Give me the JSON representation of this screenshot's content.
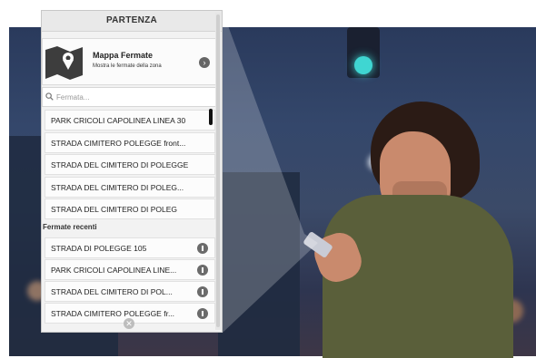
{
  "header": {
    "title": "PARTENZA"
  },
  "map_card": {
    "title": "Mappa Fermate",
    "subtitle": "Mostra le fermate della zona",
    "icon": "map-marker-icon"
  },
  "search": {
    "placeholder": "Fermata..."
  },
  "stops": [
    {
      "label": "PARK CRICOLI CAPOLINEA LINEA 30"
    },
    {
      "label": "STRADA CIMITERO POLEGGE front..."
    },
    {
      "label": "STRADA DEL CIMITERO DI POLEGGE"
    },
    {
      "label": "STRADA DEL CIMITERO DI POLEG..."
    },
    {
      "label": "STRADA DEL CIMITERO DI POLEG"
    }
  ],
  "recent": {
    "title": "Fermate recenti",
    "items": [
      {
        "label": "STRADA DI POLEGGE 105"
      },
      {
        "label": "PARK CRICOLI CAPOLINEA LINE..."
      },
      {
        "label": "STRADA DEL CIMITERO DI POL..."
      },
      {
        "label": "STRADA CIMITERO POLEGGE fr..."
      }
    ]
  },
  "colors": {
    "panel_bg": "#f2f2f2",
    "signal": "#3fd6d2",
    "icon_grey": "#6b6b6b"
  }
}
